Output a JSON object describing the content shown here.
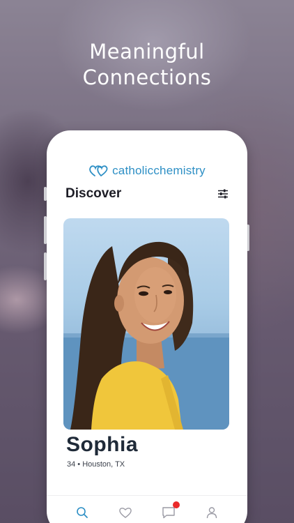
{
  "headline": {
    "line1": "Meaningful",
    "line2": "Connections"
  },
  "app": {
    "logo_text": "catholicchemistry",
    "logo_part1": "catholic",
    "logo_part2": "chemistry",
    "brand_color": "#2d8fc5"
  },
  "discover": {
    "title": "Discover",
    "filter_icon": "sliders-icon"
  },
  "profile": {
    "name": "Sophia",
    "details": "34 • Houston, TX"
  },
  "tabbar": {
    "items": [
      {
        "icon": "search-icon",
        "active": true
      },
      {
        "icon": "heart-icon",
        "active": false
      },
      {
        "icon": "chat-icon",
        "active": false,
        "badge": true
      },
      {
        "icon": "profile-icon",
        "active": false
      }
    ],
    "active_color": "#2d8fc5",
    "inactive_color": "#9a9aa4",
    "badge_color": "#ea2a2a"
  }
}
